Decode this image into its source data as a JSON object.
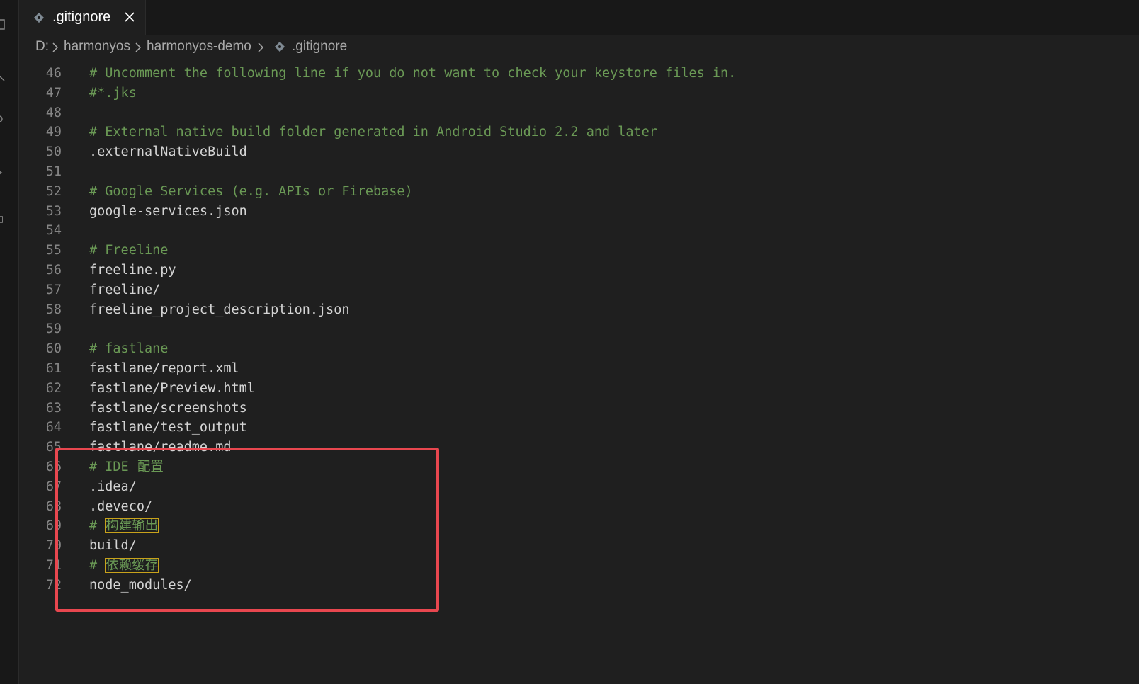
{
  "tab": {
    "label": ".gitignore",
    "file_icon": "git-diamond-icon",
    "close_icon": "close-icon"
  },
  "breadcrumb": {
    "drive": "D:",
    "folder1": "harmonyos",
    "folder2": "harmonyos-demo",
    "file": ".gitignore"
  },
  "lines": [
    {
      "num": "46",
      "text": "# Uncomment the following line if you do not want to check your keystore files in."
    },
    {
      "num": "47",
      "text": "#*.jks"
    },
    {
      "num": "48",
      "text": ""
    },
    {
      "num": "49",
      "text": "# External native build folder generated in Android Studio 2.2 and later"
    },
    {
      "num": "50",
      "text": ".externalNativeBuild"
    },
    {
      "num": "51",
      "text": ""
    },
    {
      "num": "52",
      "text": "# Google Services (e.g. APIs or Firebase)"
    },
    {
      "num": "53",
      "text": "google-services.json"
    },
    {
      "num": "54",
      "text": ""
    },
    {
      "num": "55",
      "text": "# Freeline"
    },
    {
      "num": "56",
      "text": "freeline.py"
    },
    {
      "num": "57",
      "text": "freeline/"
    },
    {
      "num": "58",
      "text": "freeline_project_description.json"
    },
    {
      "num": "59",
      "text": ""
    },
    {
      "num": "60",
      "text": "# fastlane"
    },
    {
      "num": "61",
      "text": "fastlane/report.xml"
    },
    {
      "num": "62",
      "text": "fastlane/Preview.html"
    },
    {
      "num": "63",
      "text": "fastlane/screenshots"
    },
    {
      "num": "64",
      "text": "fastlane/test_output"
    },
    {
      "num": "65",
      "text": "fastlane/readme.md"
    },
    {
      "num": "66",
      "text": "# IDE ",
      "cjk": "配置"
    },
    {
      "num": "67",
      "text": ".idea/"
    },
    {
      "num": "68",
      "text": ".deveco/"
    },
    {
      "num": "69",
      "text": "# ",
      "cjk": "构建输出"
    },
    {
      "num": "70",
      "text": "build/"
    },
    {
      "num": "71",
      "text": "# ",
      "cjk": "依赖缓存"
    },
    {
      "num": "72",
      "text": "node_modules/"
    }
  ],
  "colors": {
    "comment": "#6a9955",
    "annotation": "#e8474f",
    "cjk_highlight": "#c8a21b"
  }
}
